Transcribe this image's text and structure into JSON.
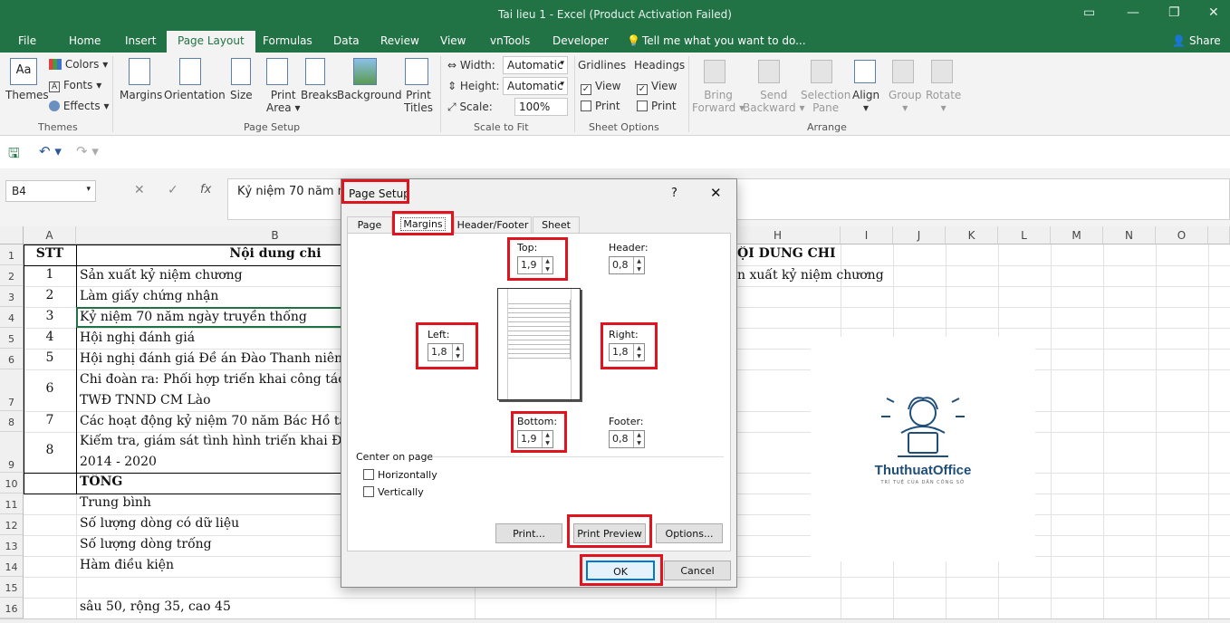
{
  "window": {
    "title": "Tai lieu 1 - Excel (Product Activation Failed)"
  },
  "tabs": [
    "File",
    "Home",
    "Insert",
    "Page Layout",
    "Formulas",
    "Data",
    "Review",
    "View",
    "vnTools",
    "Developer"
  ],
  "tell_me": "Tell me what you want to do...",
  "share": "Share",
  "ribbon": {
    "themes": {
      "themes": "Themes",
      "colors": "Colors",
      "fonts": "Fonts",
      "effects": "Effects",
      "group": "Themes"
    },
    "page_setup": {
      "margins": "Margins",
      "orientation": "Orientation",
      "size": "Size",
      "print_area_1": "Print",
      "print_area_2": "Area",
      "breaks": "Breaks",
      "background": "Background",
      "print_titles_1": "Print",
      "print_titles_2": "Titles",
      "group": "Page Setup"
    },
    "scale": {
      "width_label": "Width:",
      "width_value": "Automatic",
      "height_label": "Height:",
      "height_value": "Automatic",
      "scale_label": "Scale:",
      "scale_value": "100%",
      "group": "Scale to Fit"
    },
    "sheet_options": {
      "gridlines": "Gridlines",
      "headings": "Headings",
      "view": "View",
      "print": "Print",
      "group": "Sheet Options"
    },
    "arrange": {
      "bring_1": "Bring",
      "bring_2": "Forward",
      "send_1": "Send",
      "send_2": "Backward",
      "selection_1": "Selection",
      "selection_2": "Pane",
      "align": "Align",
      "group_btn": "Group",
      "rotate": "Rotate",
      "group": "Arrange"
    }
  },
  "formula_bar": {
    "name_box": "B4",
    "fx": "fx",
    "content": "Kỷ niệm 70 năm ng"
  },
  "columns": [
    "A",
    "B",
    "H",
    "I",
    "J",
    "K",
    "L",
    "M",
    "N",
    "O"
  ],
  "rows": [
    "1",
    "2",
    "3",
    "4",
    "5",
    "6",
    "7",
    "8",
    "9",
    "10",
    "11",
    "12",
    "13",
    "14",
    "15",
    "16"
  ],
  "cells": {
    "a1": "STT",
    "b1": "Nội dung chi",
    "a2": "1",
    "b2": "Sản xuất kỷ niệm chương",
    "a3": "2",
    "b3": "Làm giấy chứng nhận",
    "a4": "3",
    "b4": "Kỷ niệm 70 năm ngày truyền thống",
    "a5": "4",
    "b5": "Hội nghị đánh giá",
    "a6": "5",
    "b6": "Hội nghị đánh giá Đề án Đào Thanh niên",
    "a7": "6",
    "b6b": "Chi đoàn ra: Phối hợp triển khai công tác c",
    "b7": "TWĐ TNND CM Lào",
    "a8": "7",
    "b8": "Các hoạt động kỷ niệm 70 năm Bác Hồ tặng",
    "a9": "8",
    "b8b": "Kiểm tra, giám sát tình hình triển khai Đề á",
    "b9": "2014 - 2020",
    "b10": "TỔNG",
    "b11": "Trung bình",
    "b12": "Số lượng dòng có dữ liệu",
    "b13": "Số lượng dòng trống",
    "b14": "Hàm điều kiện",
    "b16": "sâu 50, rộng 35, cao 45",
    "h1": "ỘI DUNG CHI",
    "h2": "n xuất kỷ niệm chương"
  },
  "logo": {
    "text": "ThuthuatOffice",
    "tagline": "TRÍ TUỆ CỦA DÂN CÔNG SỞ"
  },
  "dialog": {
    "title": "Page Setup",
    "help": "?",
    "close": "✕",
    "tabs": [
      "Page",
      "Margins",
      "Header/Footer",
      "Sheet"
    ],
    "top_label": "Top:",
    "top_value": "1,9",
    "header_label": "Header:",
    "header_value": "0,8",
    "left_label": "Left:",
    "left_value": "1,8",
    "right_label": "Right:",
    "right_value": "1,8",
    "bottom_label": "Bottom:",
    "bottom_value": "1,9",
    "footer_label": "Footer:",
    "footer_value": "0,8",
    "center_label": "Center on page",
    "horizontally": "Horizontally",
    "vertically": "Vertically",
    "print_btn": "Print...",
    "preview_btn": "Print Preview",
    "options_btn": "Options...",
    "ok": "OK",
    "cancel": "Cancel"
  },
  "colors": {
    "excel_green": "#217346",
    "highlight_red": "#e0141e",
    "logo_blue": "#1f4e79"
  }
}
